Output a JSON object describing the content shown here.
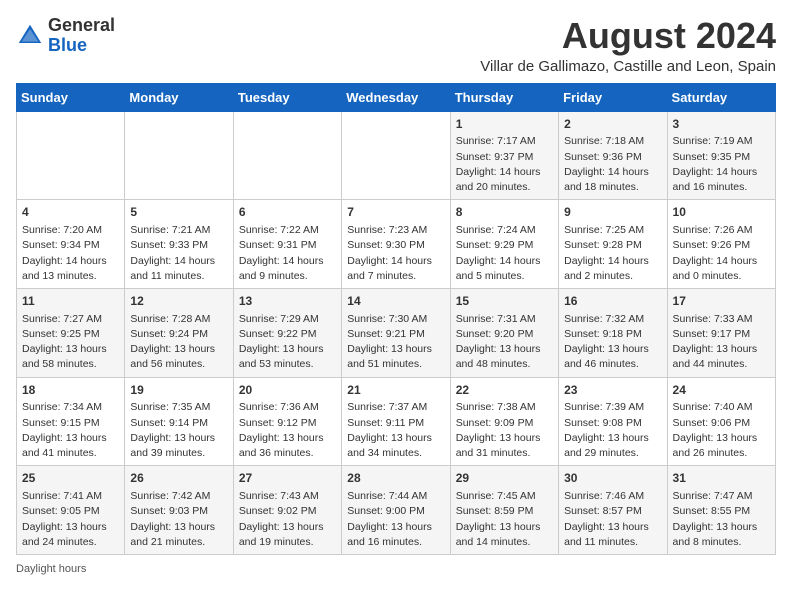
{
  "logo": {
    "general": "General",
    "blue": "Blue"
  },
  "title": {
    "month_year": "August 2024",
    "location": "Villar de Gallimazo, Castille and Leon, Spain"
  },
  "days_of_week": [
    "Sunday",
    "Monday",
    "Tuesday",
    "Wednesday",
    "Thursday",
    "Friday",
    "Saturday"
  ],
  "weeks": [
    [
      {
        "day": "",
        "info": ""
      },
      {
        "day": "",
        "info": ""
      },
      {
        "day": "",
        "info": ""
      },
      {
        "day": "",
        "info": ""
      },
      {
        "day": "1",
        "info": "Sunrise: 7:17 AM\nSunset: 9:37 PM\nDaylight: 14 hours and 20 minutes."
      },
      {
        "day": "2",
        "info": "Sunrise: 7:18 AM\nSunset: 9:36 PM\nDaylight: 14 hours and 18 minutes."
      },
      {
        "day": "3",
        "info": "Sunrise: 7:19 AM\nSunset: 9:35 PM\nDaylight: 14 hours and 16 minutes."
      }
    ],
    [
      {
        "day": "4",
        "info": "Sunrise: 7:20 AM\nSunset: 9:34 PM\nDaylight: 14 hours and 13 minutes."
      },
      {
        "day": "5",
        "info": "Sunrise: 7:21 AM\nSunset: 9:33 PM\nDaylight: 14 hours and 11 minutes."
      },
      {
        "day": "6",
        "info": "Sunrise: 7:22 AM\nSunset: 9:31 PM\nDaylight: 14 hours and 9 minutes."
      },
      {
        "day": "7",
        "info": "Sunrise: 7:23 AM\nSunset: 9:30 PM\nDaylight: 14 hours and 7 minutes."
      },
      {
        "day": "8",
        "info": "Sunrise: 7:24 AM\nSunset: 9:29 PM\nDaylight: 14 hours and 5 minutes."
      },
      {
        "day": "9",
        "info": "Sunrise: 7:25 AM\nSunset: 9:28 PM\nDaylight: 14 hours and 2 minutes."
      },
      {
        "day": "10",
        "info": "Sunrise: 7:26 AM\nSunset: 9:26 PM\nDaylight: 14 hours and 0 minutes."
      }
    ],
    [
      {
        "day": "11",
        "info": "Sunrise: 7:27 AM\nSunset: 9:25 PM\nDaylight: 13 hours and 58 minutes."
      },
      {
        "day": "12",
        "info": "Sunrise: 7:28 AM\nSunset: 9:24 PM\nDaylight: 13 hours and 56 minutes."
      },
      {
        "day": "13",
        "info": "Sunrise: 7:29 AM\nSunset: 9:22 PM\nDaylight: 13 hours and 53 minutes."
      },
      {
        "day": "14",
        "info": "Sunrise: 7:30 AM\nSunset: 9:21 PM\nDaylight: 13 hours and 51 minutes."
      },
      {
        "day": "15",
        "info": "Sunrise: 7:31 AM\nSunset: 9:20 PM\nDaylight: 13 hours and 48 minutes."
      },
      {
        "day": "16",
        "info": "Sunrise: 7:32 AM\nSunset: 9:18 PM\nDaylight: 13 hours and 46 minutes."
      },
      {
        "day": "17",
        "info": "Sunrise: 7:33 AM\nSunset: 9:17 PM\nDaylight: 13 hours and 44 minutes."
      }
    ],
    [
      {
        "day": "18",
        "info": "Sunrise: 7:34 AM\nSunset: 9:15 PM\nDaylight: 13 hours and 41 minutes."
      },
      {
        "day": "19",
        "info": "Sunrise: 7:35 AM\nSunset: 9:14 PM\nDaylight: 13 hours and 39 minutes."
      },
      {
        "day": "20",
        "info": "Sunrise: 7:36 AM\nSunset: 9:12 PM\nDaylight: 13 hours and 36 minutes."
      },
      {
        "day": "21",
        "info": "Sunrise: 7:37 AM\nSunset: 9:11 PM\nDaylight: 13 hours and 34 minutes."
      },
      {
        "day": "22",
        "info": "Sunrise: 7:38 AM\nSunset: 9:09 PM\nDaylight: 13 hours and 31 minutes."
      },
      {
        "day": "23",
        "info": "Sunrise: 7:39 AM\nSunset: 9:08 PM\nDaylight: 13 hours and 29 minutes."
      },
      {
        "day": "24",
        "info": "Sunrise: 7:40 AM\nSunset: 9:06 PM\nDaylight: 13 hours and 26 minutes."
      }
    ],
    [
      {
        "day": "25",
        "info": "Sunrise: 7:41 AM\nSunset: 9:05 PM\nDaylight: 13 hours and 24 minutes."
      },
      {
        "day": "26",
        "info": "Sunrise: 7:42 AM\nSunset: 9:03 PM\nDaylight: 13 hours and 21 minutes."
      },
      {
        "day": "27",
        "info": "Sunrise: 7:43 AM\nSunset: 9:02 PM\nDaylight: 13 hours and 19 minutes."
      },
      {
        "day": "28",
        "info": "Sunrise: 7:44 AM\nSunset: 9:00 PM\nDaylight: 13 hours and 16 minutes."
      },
      {
        "day": "29",
        "info": "Sunrise: 7:45 AM\nSunset: 8:59 PM\nDaylight: 13 hours and 14 minutes."
      },
      {
        "day": "30",
        "info": "Sunrise: 7:46 AM\nSunset: 8:57 PM\nDaylight: 13 hours and 11 minutes."
      },
      {
        "day": "31",
        "info": "Sunrise: 7:47 AM\nSunset: 8:55 PM\nDaylight: 13 hours and 8 minutes."
      }
    ]
  ],
  "footer": {
    "daylight_label": "Daylight hours"
  }
}
